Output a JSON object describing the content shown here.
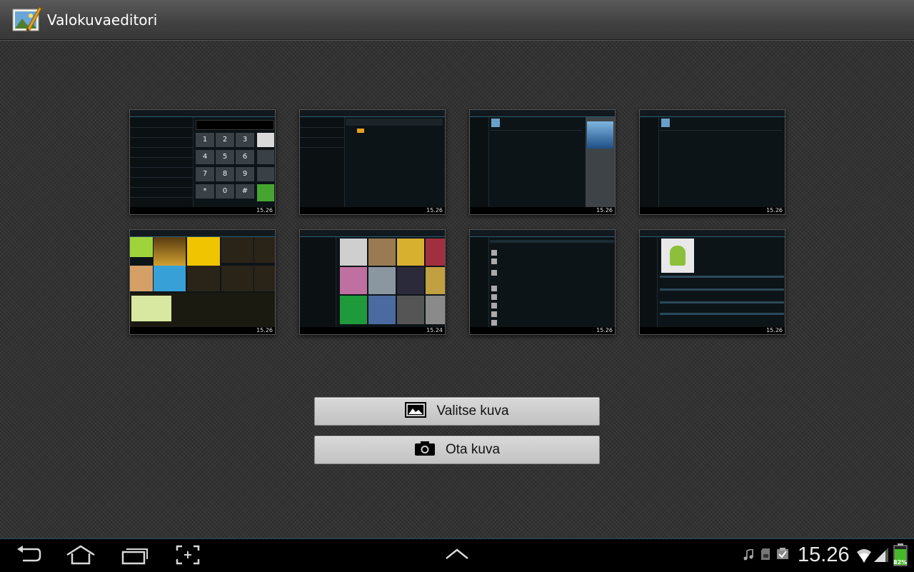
{
  "app": {
    "title": "Valokuvaeditori"
  },
  "buttons": {
    "choose_image": "Valitse kuva",
    "take_image": "Ota kuva"
  },
  "status": {
    "time": "15.26",
    "battery": "82%"
  },
  "thumbnails": [
    {
      "name": "dialer",
      "time": "15.26"
    },
    {
      "name": "files",
      "time": "15.26"
    },
    {
      "name": "music-player",
      "time": "15.26"
    },
    {
      "name": "music-library",
      "time": "15.26"
    },
    {
      "name": "game-store",
      "time": "15.26"
    },
    {
      "name": "artists-grid",
      "time": "15.24"
    },
    {
      "name": "contacts-list",
      "time": "15.26"
    },
    {
      "name": "contact-detail",
      "time": "15.26"
    }
  ],
  "dialer_keys": [
    "1",
    "2",
    "3",
    "4",
    "5",
    "6",
    "7",
    "8",
    "9",
    "*",
    "0",
    "#"
  ],
  "icons": {
    "back": "back-icon",
    "home": "home-icon",
    "recents": "recent-apps-icon",
    "screenshot": "screenshot-icon",
    "up": "chevron-up-icon",
    "music": "music-note-icon",
    "sd": "sd-card-icon",
    "clipboard": "clipboard-check-icon",
    "wifi": "wifi-icon",
    "signal": "signal-icon",
    "battery": "battery-icon"
  },
  "colors": {
    "accent": "#2b7fa6",
    "button_bg": "#cfcfcf",
    "system_bar": "#000000"
  }
}
